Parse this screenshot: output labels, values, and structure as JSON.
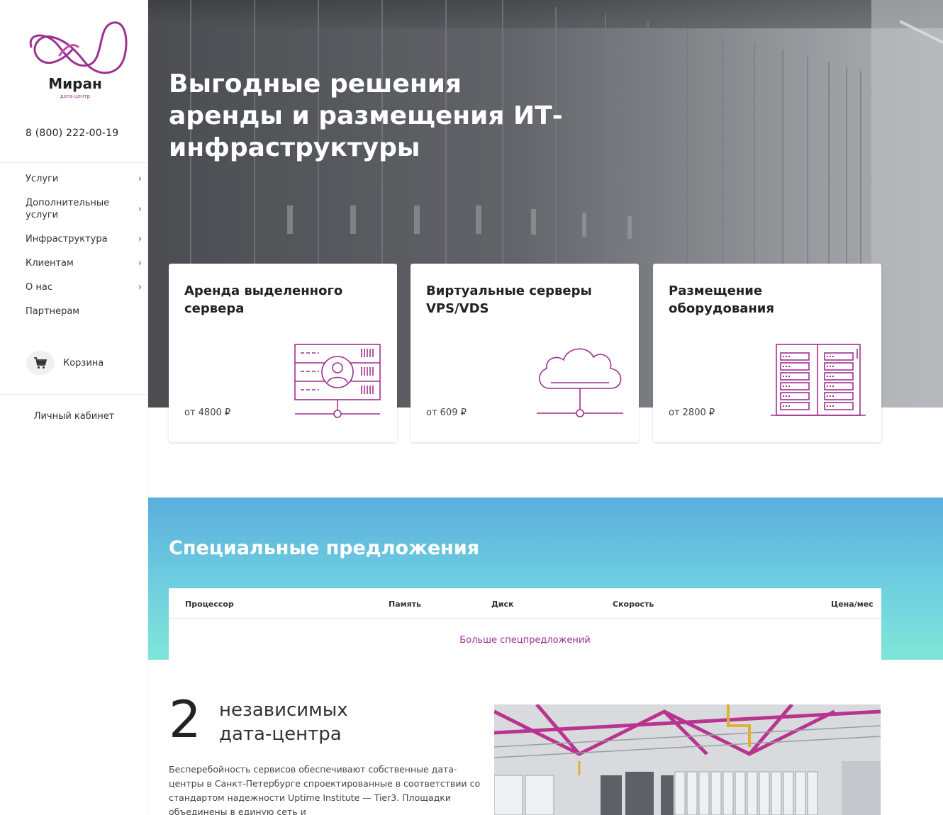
{
  "brand": {
    "name": "Миран",
    "subtitle": "дата-центр",
    "accent_color": "#a0308f"
  },
  "sidebar": {
    "phone": "8 (800) 222-00-19",
    "nav": [
      {
        "label": "Услуги",
        "has_submenu": true
      },
      {
        "label": "Дополнительные услуги",
        "has_submenu": true
      },
      {
        "label": "Инфраструктура",
        "has_submenu": true
      },
      {
        "label": "Клиентам",
        "has_submenu": true
      },
      {
        "label": "О нас",
        "has_submenu": true
      },
      {
        "label": "Партнерам",
        "has_submenu": false
      }
    ],
    "chevron": "›",
    "cart_label": "Корзина",
    "cabinet_label": "Личный кабинет"
  },
  "hero": {
    "title": "Выгодные решения аренды и размещения ИТ-инфраструктуры"
  },
  "cards": [
    {
      "title": "Аренда выделенного сервера",
      "price": "от 4800 ₽",
      "icon": "server-user-icon"
    },
    {
      "title": "Виртуальные серверы VPS/VDS",
      "price": "от 609 ₽",
      "icon": "cloud-network-icon"
    },
    {
      "title": "Размещение оборудования",
      "price": "от 2800 ₽",
      "icon": "rack-icon"
    }
  ],
  "offers": {
    "title": "Специальные предложения",
    "columns": [
      "Процессор",
      "Память",
      "Диск",
      "Скорость",
      "Цена/мес"
    ],
    "more_link": "Больше спецпредложений"
  },
  "datacenters": {
    "count": "2",
    "title": "независимых дата-центра",
    "text": "Бесперебойность сервисов обеспечивают собственные дата-центры в Санкт-Петербурге спроектированные в соответствии со стандартом надежности Uptime Institute — Tier3. Площадки объединены в единую сеть и"
  }
}
